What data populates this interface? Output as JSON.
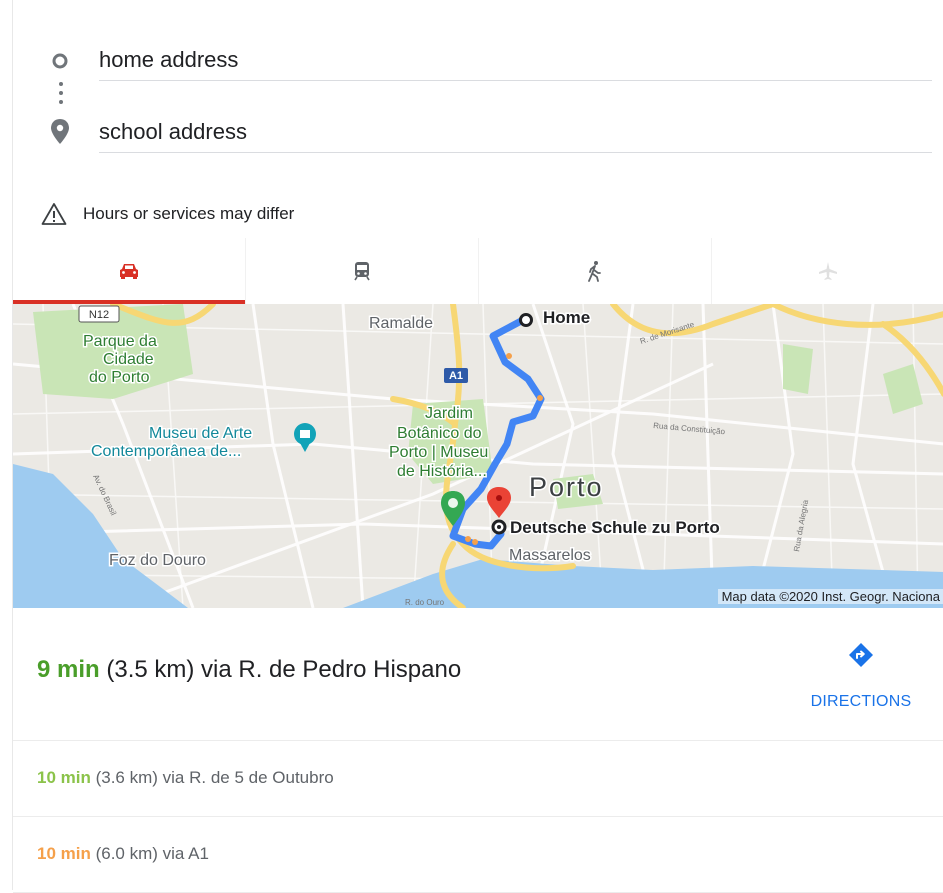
{
  "waypoints": {
    "origin": "home address",
    "destination": "school address"
  },
  "notice": {
    "text": "Hours or services may differ",
    "icon": "warning-icon"
  },
  "tabs": [
    {
      "icon": "car-icon",
      "active": true
    },
    {
      "icon": "transit-icon",
      "active": false
    },
    {
      "icon": "walk-icon",
      "active": false
    },
    {
      "icon": "flight-icon",
      "active": false
    }
  ],
  "map": {
    "road_shield": "N12",
    "motorway_shield": "A1",
    "labels": {
      "ramalde": "Ramalde",
      "parque_1": "Parque da",
      "parque_2": "Cidade",
      "parque_3": "do Porto",
      "museu_arte_1": "Museu de Arte",
      "museu_arte_2": "Contemporânea de...",
      "jardim_1": "Jardim",
      "jardim_2": "Botânico do",
      "jardim_3": "Porto | Museu",
      "jardim_4": "de História...",
      "porto": "Porto",
      "foz": "Foz do Douro",
      "massarelos": "Massarelos",
      "street_morisante": "R. de Morisante",
      "street_constituicao": "Rua da Constituição",
      "street_brasil": "Av. do Brasil",
      "street_alegria": "Rua da Alegria",
      "street_ouro": "R. do Ouro"
    },
    "origin_label": "Home",
    "destination_label": "Deutsche Schule zu Porto",
    "attribution": "Map data ©2020 Inst. Geogr. Naciona",
    "colors": {
      "route": "#4285f4",
      "water": "#9ecbf0",
      "park": "#c9e5b6",
      "pin": "#ea4335"
    }
  },
  "routes": {
    "best": {
      "duration": "9 min",
      "details": " (3.5 km) via R. de Pedro Hispano"
    },
    "directions_label": "DIRECTIONS",
    "alt1": {
      "duration": "10 min",
      "details": " (3.6 km) via R. de 5 de Outubro"
    },
    "alt2": {
      "duration": "10 min",
      "details": " (6.0 km) via A1"
    }
  }
}
